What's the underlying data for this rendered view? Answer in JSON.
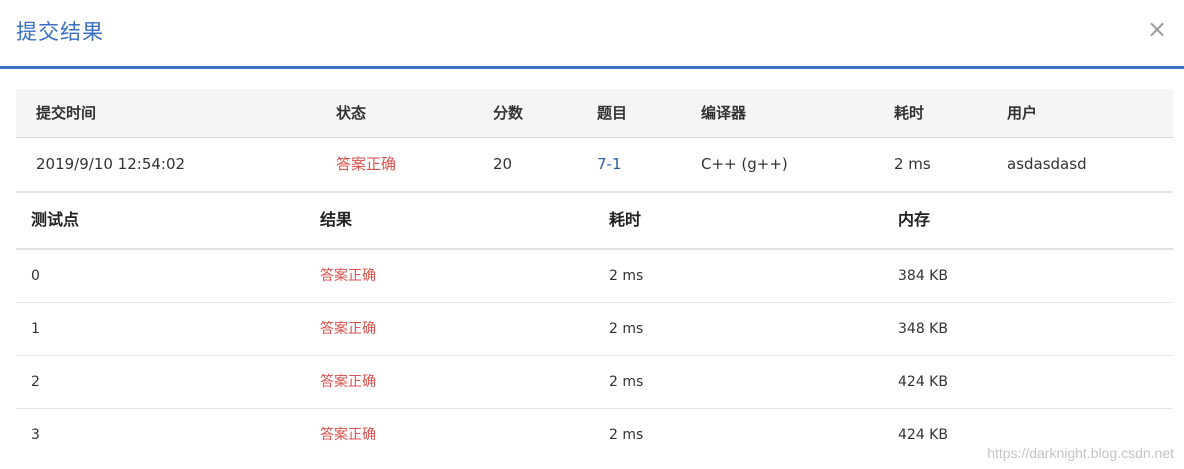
{
  "dialog": {
    "title": "提交结果",
    "close_label": "×"
  },
  "summary": {
    "headers": [
      "提交时间",
      "状态",
      "分数",
      "题目",
      "编译器",
      "耗时",
      "用户"
    ],
    "row": {
      "time": "2019/9/10 12:54:02",
      "status": "答案正确",
      "score": "20",
      "problem": "7-1",
      "compiler": "C++ (g++)",
      "duration": "2 ms",
      "user": "asdasdasd"
    }
  },
  "cases": {
    "headers": [
      "测试点",
      "结果",
      "耗时",
      "内存"
    ],
    "rows": [
      {
        "id": "0",
        "result": "答案正确",
        "time": "2 ms",
        "memory": "384 KB"
      },
      {
        "id": "1",
        "result": "答案正确",
        "time": "2 ms",
        "memory": "348 KB"
      },
      {
        "id": "2",
        "result": "答案正确",
        "time": "2 ms",
        "memory": "424 KB"
      },
      {
        "id": "3",
        "result": "答案正确",
        "time": "2 ms",
        "memory": "424 KB"
      }
    ]
  },
  "watermark": "https://darknight.blog.csdn.net",
  "colors": {
    "accent": "#3a6fc4",
    "success_text": "#d9534f",
    "link": "#2c5f9e"
  }
}
